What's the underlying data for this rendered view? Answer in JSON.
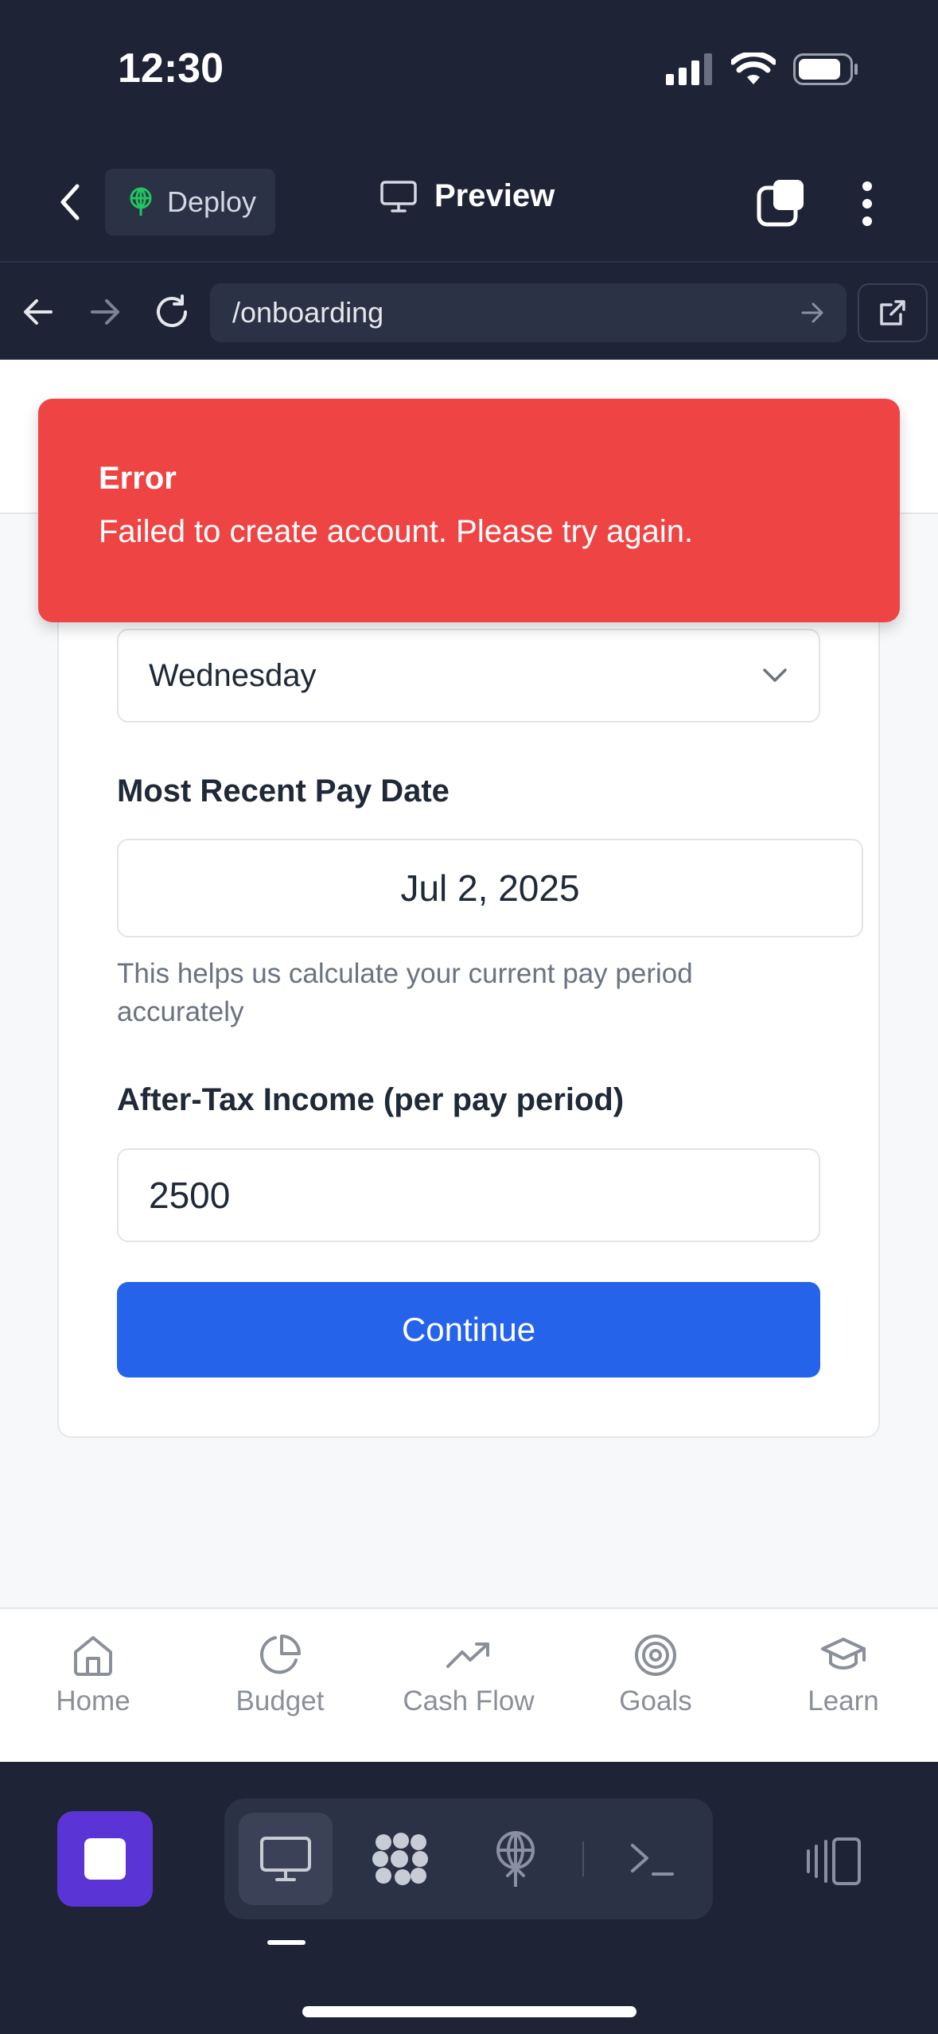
{
  "status_bar": {
    "time": "12:30"
  },
  "header": {
    "deploy_label": "Deploy",
    "preview_label": "Preview"
  },
  "browser": {
    "url": "/onboarding"
  },
  "toast": {
    "title": "Error",
    "message": "Failed to create account. Please try again."
  },
  "form": {
    "pay_day_value": "Wednesday",
    "pay_date_label": "Most Recent Pay Date",
    "pay_date_value": "Jul 2, 2025",
    "pay_date_helper": "This helps us calculate your current pay period accurately",
    "income_label": "After-Tax Income (per pay period)",
    "income_value": "2500",
    "continue_label": "Continue"
  },
  "tabbar": {
    "items": [
      {
        "label": "Home",
        "icon": "home-icon"
      },
      {
        "label": "Budget",
        "icon": "pie-chart-icon"
      },
      {
        "label": "Cash Flow",
        "icon": "trending-up-icon"
      },
      {
        "label": "Goals",
        "icon": "target-icon"
      },
      {
        "label": "Learn",
        "icon": "graduation-cap-icon"
      }
    ]
  },
  "colors": {
    "app_bg": "#1e2336",
    "error": "#ef4444",
    "primary": "#2563eb",
    "stop_button": "#5b34d6"
  }
}
